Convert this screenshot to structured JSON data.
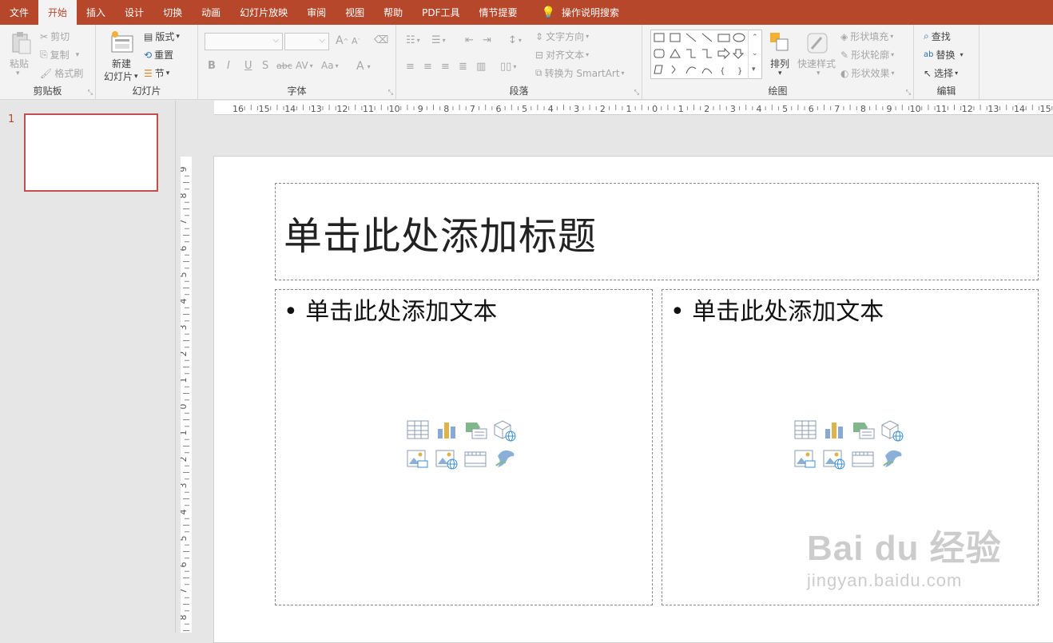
{
  "tabs": [
    {
      "label": "文件",
      "active": false
    },
    {
      "label": "开始",
      "active": true
    },
    {
      "label": "插入",
      "active": false
    },
    {
      "label": "设计",
      "active": false
    },
    {
      "label": "切换",
      "active": false
    },
    {
      "label": "动画",
      "active": false
    },
    {
      "label": "幻灯片放映",
      "active": false
    },
    {
      "label": "审阅",
      "active": false
    },
    {
      "label": "视图",
      "active": false
    },
    {
      "label": "帮助",
      "active": false
    },
    {
      "label": "PDF工具",
      "active": false
    },
    {
      "label": "情节提要",
      "active": false
    }
  ],
  "tell_me": "操作说明搜索",
  "ribbon": {
    "clipboard": {
      "label": "剪贴板",
      "paste": "粘贴",
      "cut": "剪切",
      "copy": "复制",
      "format_painter": "格式刷"
    },
    "slides": {
      "label": "幻灯片",
      "new_slide_1": "新建",
      "new_slide_2": "幻灯片",
      "layout": "版式",
      "reset": "重置",
      "section": "节"
    },
    "font": {
      "label": "字体",
      "bold": "B",
      "italic": "I",
      "underline": "U",
      "shadow": "S",
      "strike": "abc",
      "spacing": "AV",
      "case": "Aa",
      "color": "A",
      "grow": "A",
      "shrink": "A"
    },
    "paragraph": {
      "label": "段落",
      "text_direction": "文字方向",
      "align_text": "对齐文本",
      "smartart": "转换为 SmartArt"
    },
    "drawing": {
      "label": "绘图",
      "arrange": "排列",
      "quick_styles": "快速样式",
      "shape_fill": "形状填充",
      "shape_outline": "形状轮廓",
      "shape_effects": "形状效果"
    },
    "editing": {
      "label": "编辑",
      "find": "查找",
      "replace": "替换",
      "select": "选择"
    }
  },
  "ruler": {
    "h_ticks": [
      "16",
      "15",
      "14",
      "13",
      "12",
      "11",
      "10",
      "9",
      "8",
      "7",
      "6",
      "5",
      "4",
      "3",
      "2",
      "1",
      "0",
      "1",
      "2",
      "3",
      "4",
      "5",
      "6",
      "7",
      "8",
      "9",
      "10",
      "11",
      "12",
      "13",
      "14",
      "15"
    ],
    "v_ticks": [
      "9",
      "8",
      "7",
      "6",
      "5",
      "4",
      "3",
      "2",
      "1",
      "0",
      "1",
      "2",
      "3",
      "4",
      "5",
      "6",
      "7",
      "8"
    ]
  },
  "slide_panel": {
    "slide_number": "1"
  },
  "slide": {
    "title_placeholder": "单击此处添加标题",
    "left_placeholder": "单击此处添加文本",
    "right_placeholder": "单击此处添加文本",
    "bullet": "•"
  },
  "watermark": {
    "main": "Bai du 经验",
    "sub": "jingyan.baidu.com"
  },
  "colors": {
    "accent": "#b7472a",
    "ribbon_bg": "#f3f3f3",
    "canvas_bg": "#e6e6e6"
  }
}
